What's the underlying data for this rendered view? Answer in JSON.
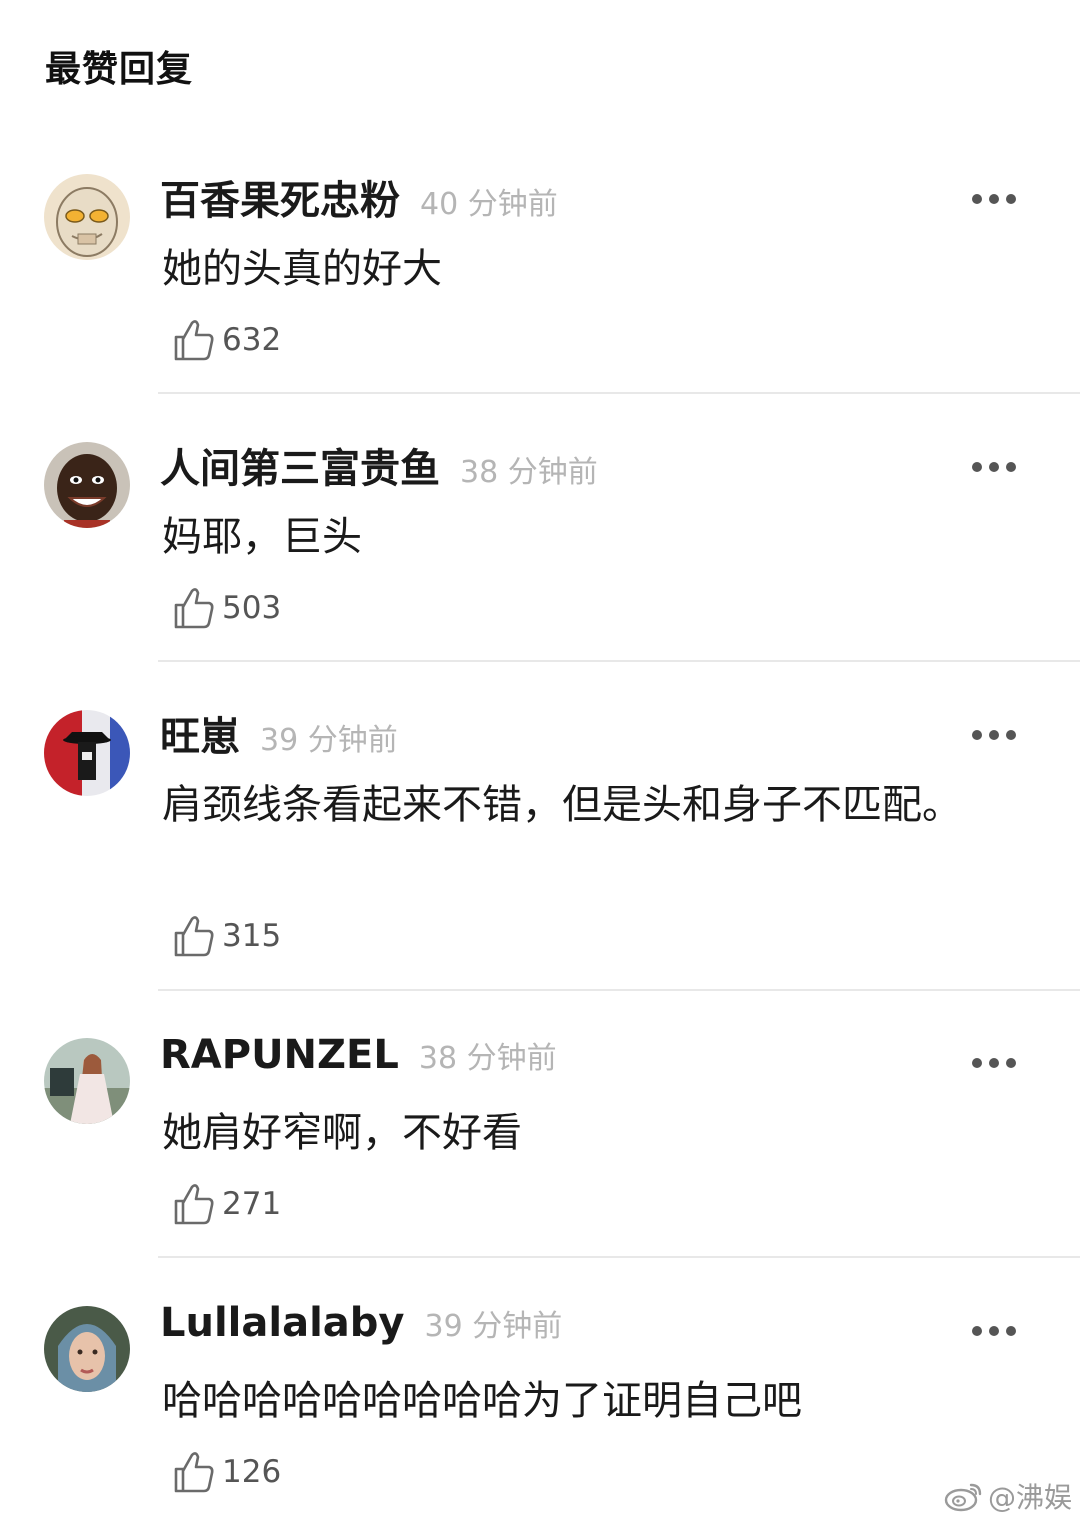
{
  "section": {
    "title": "最赞回复"
  },
  "comments": [
    {
      "username": "百香果死忠粉",
      "time": "40 分钟前",
      "text": "她的头真的好大",
      "likes": "632"
    },
    {
      "username": "人间第三富贵鱼",
      "time": "38 分钟前",
      "text": "妈耶，巨头",
      "likes": "503"
    },
    {
      "username": "旺崽",
      "time": "39 分钟前",
      "text": "肩颈线条看起来不错，但是头和身子不匹配。",
      "likes": "315"
    },
    {
      "username": "RAPUNZEL",
      "time": "38 分钟前",
      "text": "她肩好窄啊，不好看",
      "likes": "271"
    },
    {
      "username": "Lullalalaby",
      "time": "39 分钟前",
      "text": "哈哈哈哈哈哈哈哈哈为了证明自己吧",
      "likes": "126"
    }
  ],
  "watermark": {
    "text": "@沸娱",
    "icon": "weibo-icon"
  }
}
